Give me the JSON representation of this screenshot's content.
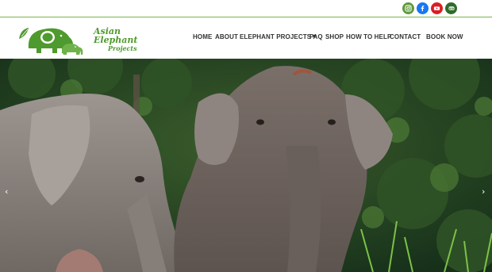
{
  "social": {
    "items": [
      {
        "name": "instagram",
        "color": "#5f9a3a"
      },
      {
        "name": "facebook",
        "color": "#1877f2"
      },
      {
        "name": "youtube",
        "color": "#d81f26"
      },
      {
        "name": "tripadvisor",
        "color": "#2f6b2a"
      }
    ]
  },
  "logo": {
    "line1": "Asian",
    "line2": "Elephant",
    "line3": "Projects",
    "brand_color": "#4f9a2e"
  },
  "nav": {
    "items": [
      {
        "label": "HOME"
      },
      {
        "label": "ABOUT"
      },
      {
        "label": "ELEPHANT PROJECTS",
        "has_dropdown": true
      },
      {
        "label": "FAQ"
      },
      {
        "label": "SHOP"
      },
      {
        "label": "HOW TO HELP"
      },
      {
        "label": "CONTACT"
      },
      {
        "label": "BOOK NOW"
      }
    ]
  },
  "hero": {
    "prev_arrow": "‹",
    "next_arrow": "›"
  }
}
